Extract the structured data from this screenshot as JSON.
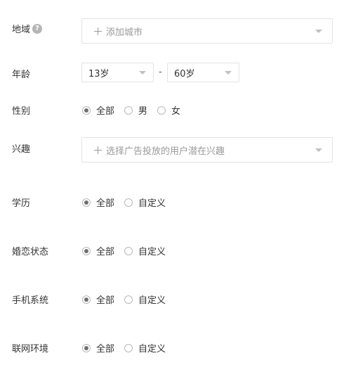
{
  "region": {
    "label": "地域",
    "help_icon": "?",
    "placeholder": "添加城市",
    "icon": "plus-icon"
  },
  "age": {
    "label": "年龄",
    "min_value": "13岁",
    "separator": "-",
    "max_value": "60岁"
  },
  "gender": {
    "label": "性别",
    "options": [
      {
        "label": "全部",
        "checked": true
      },
      {
        "label": "男",
        "checked": false
      },
      {
        "label": "女",
        "checked": false
      }
    ]
  },
  "interest": {
    "label": "兴趣",
    "placeholder": "选择广告投放的用户潜在兴趣",
    "icon": "plus-icon"
  },
  "education": {
    "label": "学历",
    "options": [
      {
        "label": "全部",
        "checked": true
      },
      {
        "label": "自定义",
        "checked": false
      }
    ]
  },
  "marital": {
    "label": "婚恋状态",
    "options": [
      {
        "label": "全部",
        "checked": true
      },
      {
        "label": "自定义",
        "checked": false
      }
    ]
  },
  "os": {
    "label": "手机系统",
    "options": [
      {
        "label": "全部",
        "checked": true
      },
      {
        "label": "自定义",
        "checked": false
      }
    ]
  },
  "network": {
    "label": "联网环境",
    "options": [
      {
        "label": "全部",
        "checked": true
      },
      {
        "label": "自定义",
        "checked": false
      }
    ]
  },
  "colors": {
    "border": "#e3e3e3",
    "placeholder": "#999999",
    "text": "#333333",
    "radio_checked": "#6f6f6f"
  }
}
